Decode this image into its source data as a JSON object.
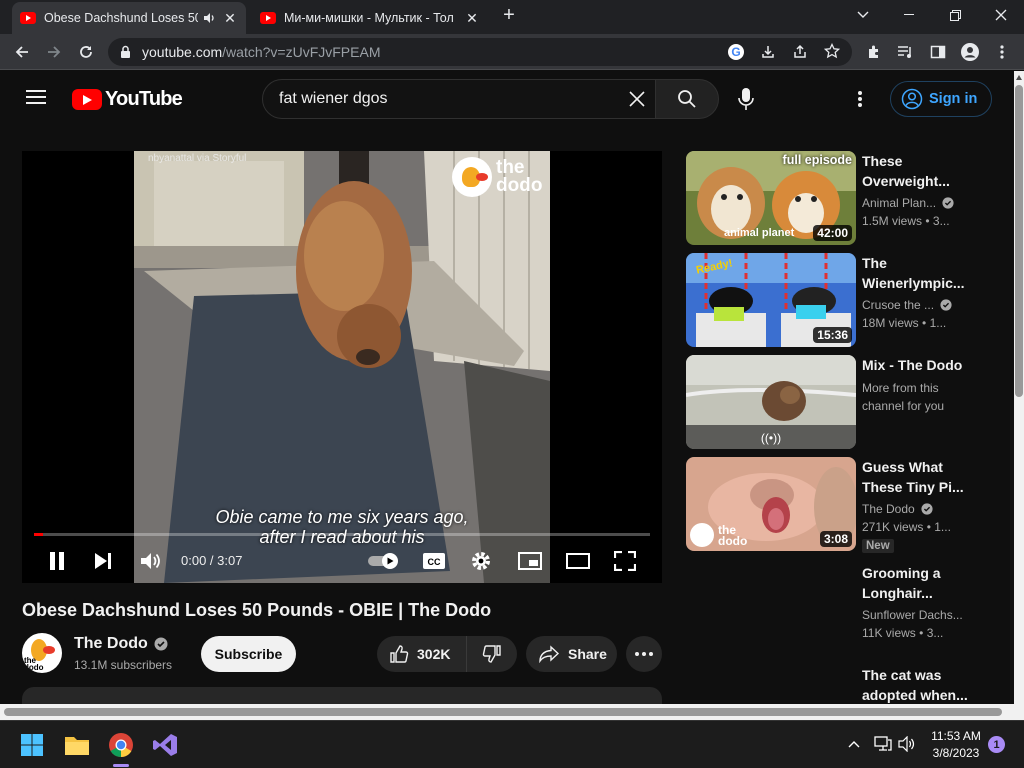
{
  "browser": {
    "tabs": [
      {
        "title": "Obese Dachshund Loses 50 P"
      },
      {
        "title": "Ми-ми-мишки - Мультик - Тол"
      }
    ],
    "url_host": "youtube.com",
    "url_path": "/watch?v=zUvFJvFPEAM"
  },
  "youtube": {
    "logo_text": "YouTube",
    "search_value": "fat wiener dgos",
    "sign_in_label": "Sign in",
    "player": {
      "overlay_credit": "nbyanattal via Storyful",
      "overlay_brand_line1": "the",
      "overlay_brand_line2": "dodo",
      "caption_line1": "Obie came to me six years ago,",
      "caption_line2": "after I read about his",
      "time_display": "0:00 / 3:07",
      "progress_fraction": 0.015
    },
    "video_title": "Obese Dachshund Loses 50 Pounds - OBIE | The Dodo",
    "channel_name": "The Dodo",
    "subscribers": "13.1M subscribers",
    "subscribe_label": "Subscribe",
    "likes": "302K",
    "share_label": "Share",
    "avatar_text_line1": "the",
    "avatar_text_line2": "dodo",
    "recommendations": [
      {
        "title_l1": "These",
        "title_l2": "Overweight...",
        "channel": "Animal Plan...",
        "verified": true,
        "views": "1.5M views",
        "age": "• 3...",
        "duration": "42:00",
        "thumb_top": "full episode",
        "thumb_bottom": "animal planet"
      },
      {
        "title_l1": "The",
        "title_l2": "Wienerlympic...",
        "channel": "Crusoe the ...",
        "verified": true,
        "views": "18M views",
        "age": "• 1...",
        "duration": "15:36",
        "thumb_top": "Ready!"
      },
      {
        "title_l1": "Mix - The Dodo",
        "title_l2": "",
        "channel": "More from this",
        "channel2": "channel for you",
        "live_icon": "((•))"
      },
      {
        "title_l1": "Guess What",
        "title_l2": "These Tiny Pi...",
        "channel": "The Dodo",
        "verified": true,
        "views": "271K views",
        "age": "• 1...",
        "duration": "3:08",
        "badge": "New",
        "thumb_bottom_l1": "the",
        "thumb_bottom_l2": "dodo"
      },
      {
        "title_l1": "Grooming a",
        "title_l2": "Longhair...",
        "channel": "Sunflower Dachs...",
        "views": "11K views",
        "age": "• 3..."
      },
      {
        "title_l1": "The cat was",
        "title_l2": "adopted when..."
      }
    ]
  },
  "taskbar": {
    "time": "11:53 AM",
    "date": "3/8/2023",
    "notification_count": "1"
  },
  "colors": {
    "yt_red": "#ff0000",
    "bg": "#0f0f0f",
    "link_blue": "#3ea6ff"
  }
}
